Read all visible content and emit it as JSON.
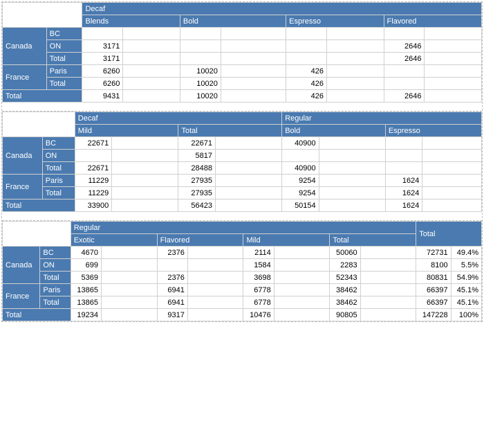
{
  "labels": {
    "decaf": "Decaf",
    "regular": "Regular",
    "blends": "Blends",
    "bold": "Bold",
    "espresso": "Espresso",
    "flavored": "Flavored",
    "mild": "Mild",
    "exotic": "Exotic",
    "total": "Total",
    "canada": "Canada",
    "france": "France",
    "bc": "BC",
    "on": "ON",
    "paris": "Paris"
  },
  "t1": {
    "rows": [
      {
        "r": "BC",
        "blends": "",
        "bold": "",
        "esp": "",
        "flav": ""
      },
      {
        "r": "ON",
        "blends": "3171",
        "bold": "",
        "esp": "",
        "flav": "2646"
      },
      {
        "r": "Total",
        "blends": "3171",
        "bold": "",
        "esp": "",
        "flav": "2646"
      },
      {
        "r": "Paris",
        "blends": "6260",
        "bold": "10020",
        "esp": "426",
        "flav": ""
      },
      {
        "r": "Total",
        "blends": "6260",
        "bold": "10020",
        "esp": "426",
        "flav": ""
      },
      {
        "r": "Total",
        "blends": "9431",
        "bold": "10020",
        "esp": "426",
        "flav": "2646"
      }
    ]
  },
  "t2": {
    "rows": [
      {
        "r": "BC",
        "mild": "22671",
        "dtot": "22671",
        "bold": "40900",
        "esp": ""
      },
      {
        "r": "ON",
        "mild": "",
        "dtot": "5817",
        "bold": "",
        "esp": ""
      },
      {
        "r": "Total",
        "mild": "22671",
        "dtot": "28488",
        "bold": "40900",
        "esp": ""
      },
      {
        "r": "Paris",
        "mild": "11229",
        "dtot": "27935",
        "bold": "9254",
        "esp": "1624"
      },
      {
        "r": "Total",
        "mild": "11229",
        "dtot": "27935",
        "bold": "9254",
        "esp": "1624"
      },
      {
        "r": "Total",
        "mild": "33900",
        "dtot": "56423",
        "bold": "50154",
        "esp": "1624"
      }
    ]
  },
  "t3": {
    "rows": [
      {
        "r": "BC",
        "ex": "4670",
        "fl": "2376",
        "mi": "2114",
        "rtot": "50060",
        "gt": "72731",
        "pct": "49.4%"
      },
      {
        "r": "ON",
        "ex": "699",
        "fl": "",
        "mi": "1584",
        "rtot": "2283",
        "gt": "8100",
        "pct": "5.5%"
      },
      {
        "r": "Total",
        "ex": "5369",
        "fl": "2376",
        "mi": "3698",
        "rtot": "52343",
        "gt": "80831",
        "pct": "54.9%"
      },
      {
        "r": "Paris",
        "ex": "13865",
        "fl": "6941",
        "mi": "6778",
        "rtot": "38462",
        "gt": "66397",
        "pct": "45.1%"
      },
      {
        "r": "Total",
        "ex": "13865",
        "fl": "6941",
        "mi": "6778",
        "rtot": "38462",
        "gt": "66397",
        "pct": "45.1%"
      },
      {
        "r": "Total",
        "ex": "19234",
        "fl": "9317",
        "mi": "10476",
        "rtot": "90805",
        "gt": "147228",
        "pct": "100%"
      }
    ]
  }
}
